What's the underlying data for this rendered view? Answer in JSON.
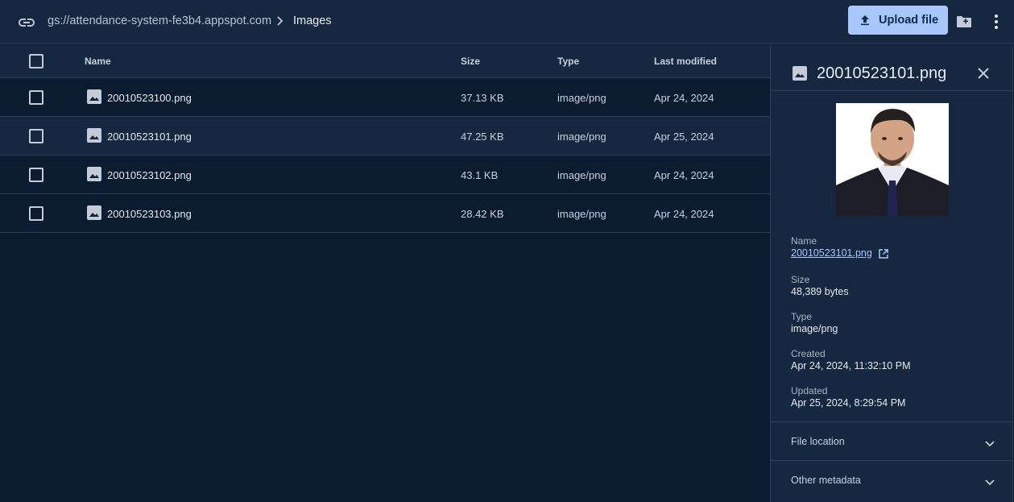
{
  "header": {
    "link_icon": "link-icon",
    "bucket_path": "gs://attendance-system-fe3b4.appspot.com",
    "separator_icon": "chevron-right-icon",
    "current_folder": "Images",
    "upload_label": "Upload file",
    "upload_icon": "upload-icon",
    "new_folder_icon": "create-folder-icon",
    "more_icon": "more-vert-icon"
  },
  "table": {
    "columns": [
      "Name",
      "Size",
      "Type",
      "Last modified"
    ],
    "rows": [
      {
        "name": "20010523100.png",
        "size": "37.13 KB",
        "type": "image/png",
        "modified": "Apr 24, 2024"
      },
      {
        "name": "20010523101.png",
        "size": "47.25 KB",
        "type": "image/png",
        "modified": "Apr 25, 2024"
      },
      {
        "name": "20010523102.png",
        "size": "43.1 KB",
        "type": "image/png",
        "modified": "Apr 24, 2024"
      },
      {
        "name": "20010523103.png",
        "size": "28.42 KB",
        "type": "image/png",
        "modified": "Apr 24, 2024"
      }
    ],
    "selected_row": 1
  },
  "details": {
    "title": "20010523101.png",
    "fields": {
      "name_label": "Name",
      "name_value": "20010523101.png",
      "size_label": "Size",
      "size_value": "48,389 bytes",
      "type_label": "Type",
      "type_value": "image/png",
      "created_label": "Created",
      "created_value": "Apr 24, 2024, 11:32:10 PM",
      "updated_label": "Updated",
      "updated_value": "Apr 25, 2024, 8:29:54 PM"
    },
    "sections": [
      "File location",
      "Other metadata"
    ]
  },
  "colors": {
    "background": "#0c1c30",
    "surface": "#15283f",
    "accent": "#a8c7fa",
    "divider": "#2b3f58"
  }
}
